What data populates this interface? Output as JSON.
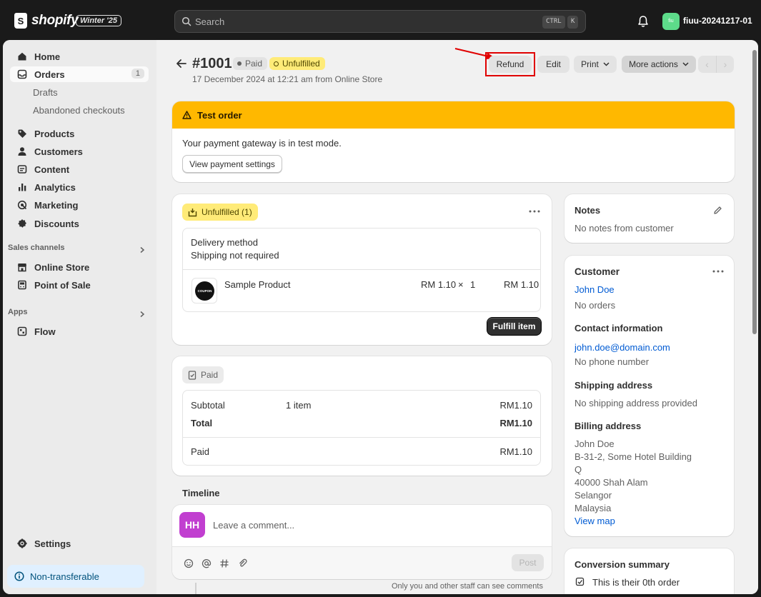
{
  "topbar": {
    "brand": "shopify",
    "badge": "Winter '25",
    "search_placeholder": "Search",
    "shortcut_ctrl": "CTRL",
    "shortcut_k": "K",
    "avatar_initials": "fiu",
    "store_name": "fiuu-20241217-01"
  },
  "sidebar": {
    "items": [
      {
        "label": "Home",
        "icon": "home-icon"
      },
      {
        "label": "Orders",
        "icon": "orders-icon",
        "count": "1"
      },
      {
        "label": "Drafts"
      },
      {
        "label": "Abandoned checkouts"
      },
      {
        "label": "Products",
        "icon": "tag-icon"
      },
      {
        "label": "Customers",
        "icon": "person-icon"
      },
      {
        "label": "Content",
        "icon": "content-icon"
      },
      {
        "label": "Analytics",
        "icon": "chart-icon"
      },
      {
        "label": "Marketing",
        "icon": "target-icon"
      },
      {
        "label": "Discounts",
        "icon": "discount-icon"
      }
    ],
    "sales_channels_title": "Sales channels",
    "sales_channels": [
      {
        "label": "Online Store",
        "icon": "store-icon"
      },
      {
        "label": "Point of Sale",
        "icon": "pos-icon"
      }
    ],
    "apps_title": "Apps",
    "apps": [
      {
        "label": "Flow",
        "icon": "flow-icon"
      }
    ],
    "settings_label": "Settings",
    "non_transferable_label": "Non-transferable"
  },
  "header": {
    "order_number": "#1001",
    "paid_badge": "Paid",
    "unfulfilled_badge": "Unfulfilled",
    "subtitle": "17 December 2024 at 12:21 am from Online Store",
    "refund_label": "Refund",
    "edit_label": "Edit",
    "print_label": "Print",
    "more_actions_label": "More actions"
  },
  "test_banner": {
    "title": "Test order",
    "message": "Your payment gateway is in test mode.",
    "button_label": "View payment settings"
  },
  "fulfillment": {
    "status_label": "Unfulfilled (1)",
    "delivery_method_label": "Delivery method",
    "delivery_method_value": "Shipping not required",
    "product_name": "Sample Product",
    "product_thumb_text": "COUPON",
    "unit_price": "RM 1.10",
    "times": "×",
    "quantity": "1",
    "line_total": "RM 1.10",
    "fulfill_button": "Fulfill item"
  },
  "payment": {
    "status_label": "Paid",
    "subtotal_label": "Subtotal",
    "subtotal_items": "1 item",
    "subtotal_value": "RM1.10",
    "total_label": "Total",
    "total_value": "RM1.10",
    "paid_label": "Paid",
    "paid_value": "RM1.10"
  },
  "timeline": {
    "title": "Timeline",
    "avatar_initials": "HH",
    "comment_placeholder": "Leave a comment...",
    "post_label": "Post",
    "footnote": "Only you and other staff can see comments"
  },
  "notes": {
    "title": "Notes",
    "text": "No notes from customer"
  },
  "customer": {
    "title": "Customer",
    "name": "John Doe",
    "orders": "No orders",
    "contact_title": "Contact information",
    "email": "john.doe@domain.com",
    "phone": "No phone number",
    "shipping_title": "Shipping address",
    "shipping_value": "No shipping address provided",
    "billing_title": "Billing address",
    "billing_lines": [
      "John Doe",
      "B-31-2, Some Hotel Building",
      "Q",
      "40000 Shah Alam",
      "Selangor",
      "Malaysia"
    ],
    "view_map": "View map"
  },
  "conversion": {
    "title": "Conversion summary",
    "text": "This is their 0th order"
  },
  "colors": {
    "warning": "#ffb800",
    "unfulfilled": "#ffeb78",
    "link": "#005bd3",
    "highlight": "#e00000"
  }
}
